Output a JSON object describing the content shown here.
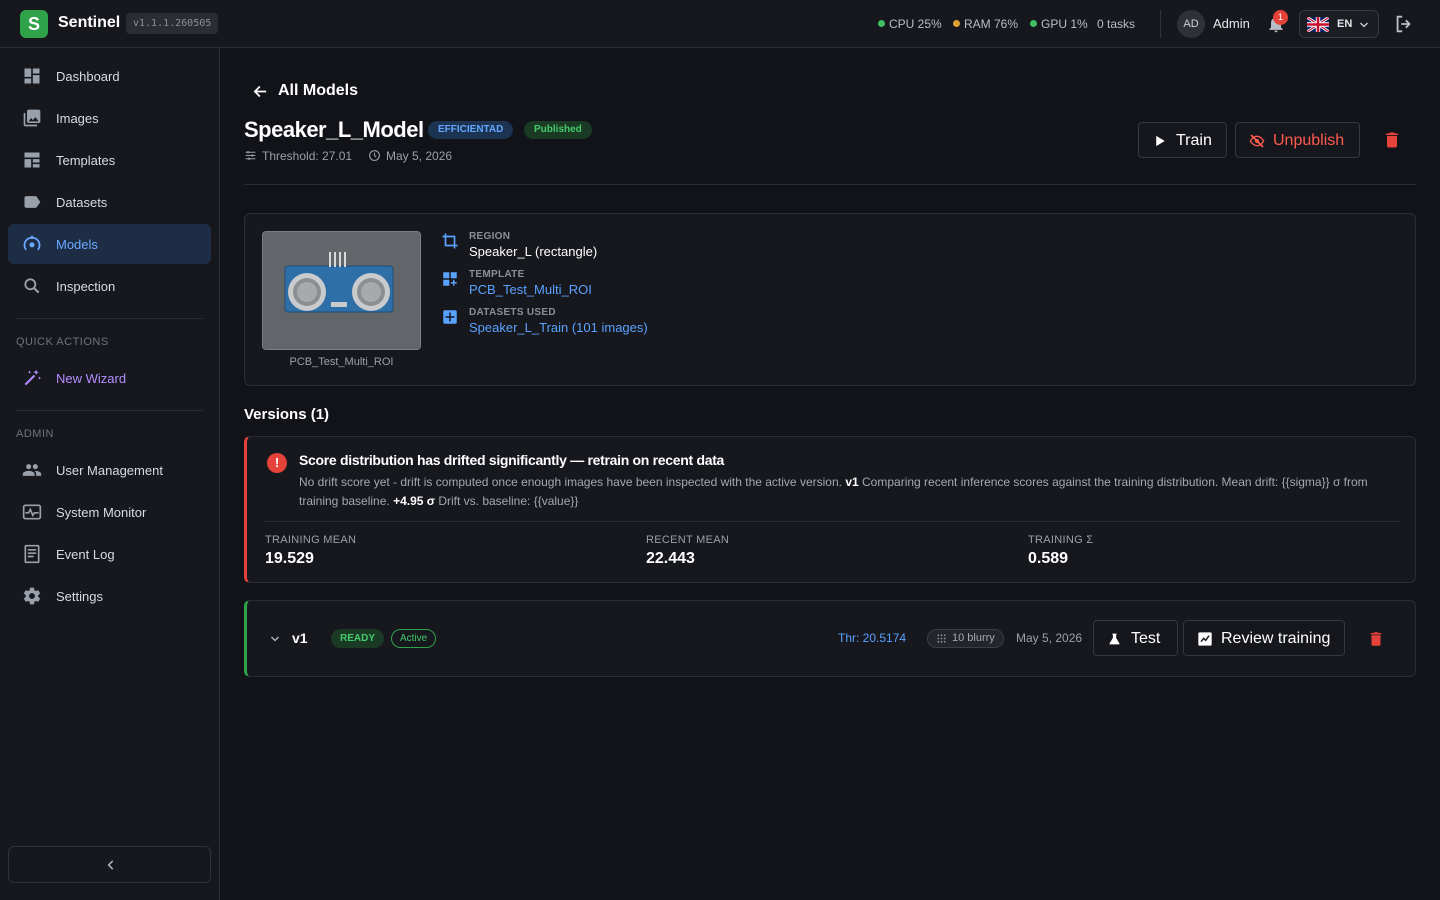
{
  "header": {
    "logo_letter": "S",
    "brand": "Sentinel",
    "version": "v1.1.1.260505",
    "stats": {
      "cpu": "CPU 25%",
      "ram": "RAM 76%",
      "gpu": "GPU 1%",
      "tasks": "0 tasks"
    },
    "stat_colors": {
      "cpu": "#3fbf5f",
      "ram": "#e0a030",
      "gpu": "#3fbf5f"
    },
    "user_initials": "AD",
    "user_name": "Admin",
    "notifications": "1",
    "language": "EN"
  },
  "sidebar": {
    "items": [
      {
        "label": "Dashboard",
        "icon": "dashboard-icon"
      },
      {
        "label": "Images",
        "icon": "images-icon"
      },
      {
        "label": "Templates",
        "icon": "templates-icon"
      },
      {
        "label": "Datasets",
        "icon": "datasets-icon"
      },
      {
        "label": "Models",
        "icon": "models-icon",
        "active": true
      },
      {
        "label": "Inspection",
        "icon": "search-icon"
      }
    ],
    "quick_actions_label": "QUICK ACTIONS",
    "quick_actions": [
      {
        "label": "New Wizard",
        "icon": "wand-icon"
      }
    ],
    "admin_label": "ADMIN",
    "admin_items": [
      {
        "label": "User Management",
        "icon": "users-icon"
      },
      {
        "label": "System Monitor",
        "icon": "monitor-icon"
      },
      {
        "label": "Event Log",
        "icon": "log-icon"
      },
      {
        "label": "Settings",
        "icon": "gear-icon"
      }
    ]
  },
  "main": {
    "back_label": "All Models",
    "model_name": "Speaker_L_Model",
    "backbone_tag": "EFFICIENTAD",
    "status_tag": "Published",
    "threshold": "Threshold: 27.01",
    "date": "May 5, 2026",
    "actions": {
      "train": "Train",
      "unpublish": "Unpublish"
    },
    "info": {
      "thumbnail_caption": "PCB_Test_Multi_ROI",
      "region_label": "REGION",
      "region_value": "Speaker_L (rectangle)",
      "template_label": "TEMPLATE",
      "template_value": "PCB_Test_Multi_ROI",
      "datasets_label": "DATASETS USED",
      "datasets_value": "Speaker_L_Train (101 images)"
    },
    "versions_title": "Versions (1)",
    "drift_alert": {
      "title": "Score distribution has drifted significantly — retrain on recent data",
      "body_1": "No drift score yet - drift is computed once enough images have been inspected with the active version.",
      "body_version": "v1",
      "body_2": "Comparing recent inference scores against the training distribution. Mean drift: {{sigma}} σ from training baseline.",
      "body_sigma": "+4.95 σ",
      "body_3": "Drift vs. baseline: {{value}}",
      "stats": [
        {
          "label": "TRAINING MEAN",
          "value": "19.529"
        },
        {
          "label": "RECENT MEAN",
          "value": "22.443"
        },
        {
          "label": "TRAINING Σ",
          "value": "0.589"
        }
      ]
    },
    "version_rows": [
      {
        "name": "v1",
        "state": "READY",
        "badge": "Active",
        "threshold": "Thr: 20.5174",
        "blurry": "10 blurry",
        "date": "May 5, 2026",
        "test_label": "Test",
        "review_label": "Review training"
      }
    ]
  }
}
